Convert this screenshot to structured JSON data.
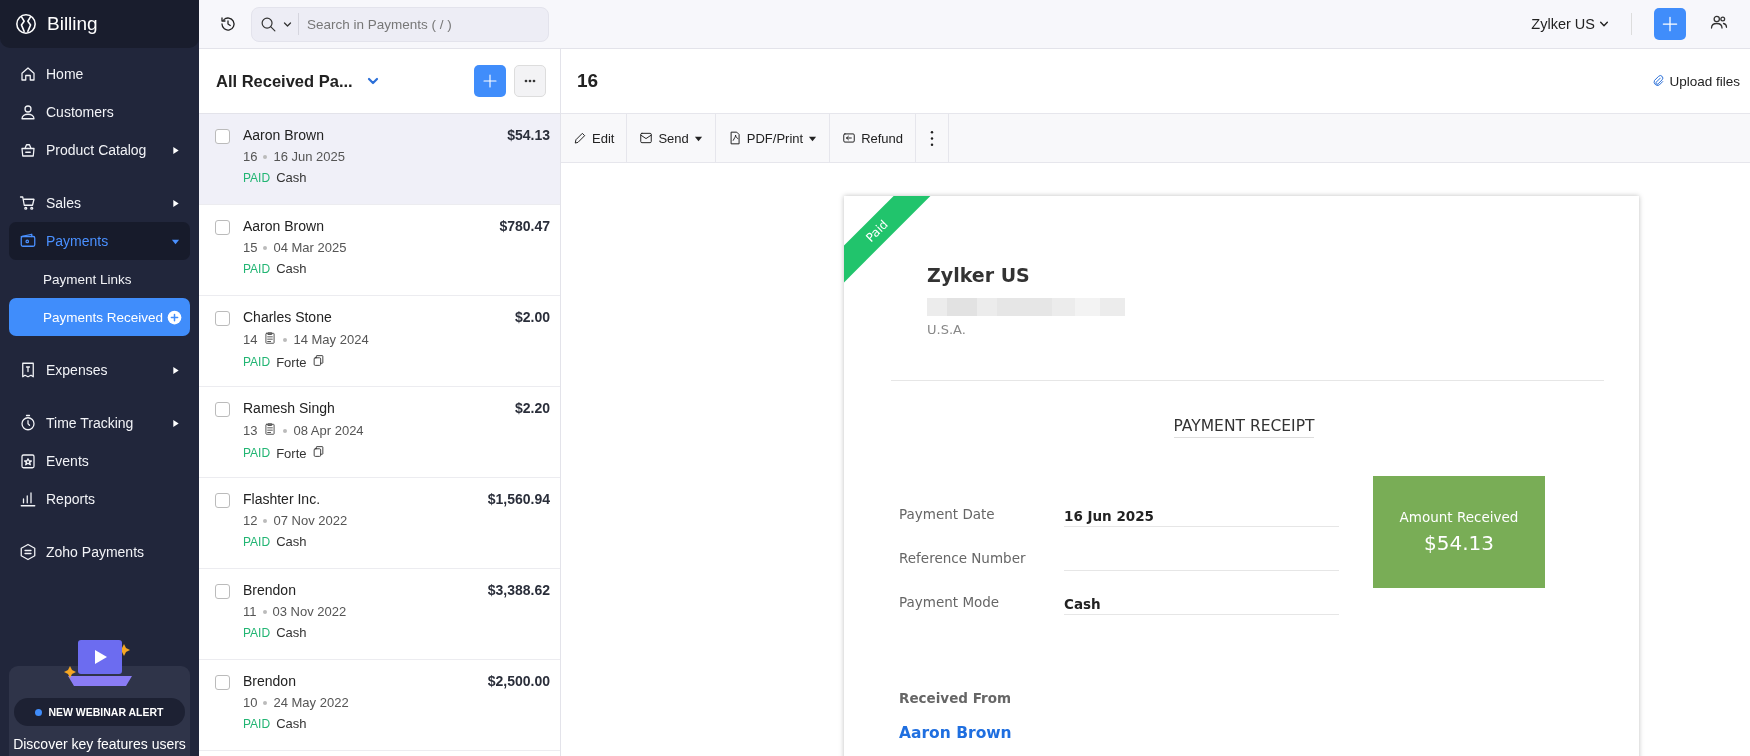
{
  "app": {
    "name": "Billing"
  },
  "sidebar": {
    "groups": [
      [
        {
          "label": "Home",
          "selected": false
        },
        {
          "label": "Customers",
          "selected": false
        },
        {
          "label": "Product Catalog",
          "selected": false,
          "expanded": false
        }
      ],
      [
        {
          "label": "Sales",
          "selected": false,
          "expanded": false
        },
        {
          "label": "Payments",
          "selected": true,
          "expanded": true,
          "children": [
            {
              "label": "Payment Links",
              "selected": false
            },
            {
              "label": "Payments Received",
              "selected": true
            }
          ]
        }
      ],
      [
        {
          "label": "Expenses",
          "selected": false,
          "expanded": false
        }
      ],
      [
        {
          "label": "Time Tracking",
          "selected": false,
          "expanded": false
        },
        {
          "label": "Events",
          "selected": false
        },
        {
          "label": "Reports",
          "selected": false
        }
      ],
      [
        {
          "label": "Zoho Payments",
          "selected": false
        }
      ]
    ],
    "promo": {
      "badge": "NEW WEBINAR ALERT",
      "text": "Discover key features users"
    }
  },
  "topbar": {
    "search": {
      "placeholder": "Search in Payments ( / )"
    },
    "organization": "Zylker US"
  },
  "list": {
    "title": "All Received Pa...",
    "rows": [
      {
        "name": "Aaron Brown",
        "amount": "$54.13",
        "number": "16",
        "date": "16 Jun 2025",
        "status": "PAID",
        "mode": "Cash",
        "selected": true,
        "has_note": false,
        "has_copy": false
      },
      {
        "name": "Aaron Brown",
        "amount": "$780.47",
        "number": "15",
        "date": "04 Mar 2025",
        "status": "PAID",
        "mode": "Cash",
        "selected": false,
        "has_note": false,
        "has_copy": false
      },
      {
        "name": "Charles Stone",
        "amount": "$2.00",
        "number": "14",
        "date": "14 May 2024",
        "status": "PAID",
        "mode": "Forte",
        "selected": false,
        "has_note": true,
        "has_copy": true
      },
      {
        "name": "Ramesh Singh",
        "amount": "$2.20",
        "number": "13",
        "date": "08 Apr 2024",
        "status": "PAID",
        "mode": "Forte",
        "selected": false,
        "has_note": true,
        "has_copy": true
      },
      {
        "name": "Flashter Inc.",
        "amount": "$1,560.94",
        "number": "12",
        "date": "07 Nov 2022",
        "status": "PAID",
        "mode": "Cash",
        "selected": false,
        "has_note": false,
        "has_copy": false
      },
      {
        "name": "Brendon",
        "amount": "$3,388.62",
        "number": "11",
        "date": "03 Nov 2022",
        "status": "PAID",
        "mode": "Cash",
        "selected": false,
        "has_note": false,
        "has_copy": false
      },
      {
        "name": "Brendon",
        "amount": "$2,500.00",
        "number": "10",
        "date": "24 May 2022",
        "status": "PAID",
        "mode": "Cash",
        "selected": false,
        "has_note": false,
        "has_copy": false
      }
    ]
  },
  "detail": {
    "title": "16",
    "upload": "Upload files",
    "toolbar": [
      {
        "label": "Edit",
        "dropdown": false
      },
      {
        "label": "Send",
        "dropdown": true
      },
      {
        "label": "PDF/Print",
        "dropdown": true
      },
      {
        "label": "Refund",
        "dropdown": false
      }
    ],
    "receipt": {
      "ribbon": "Paid",
      "company": "Zylker US",
      "country": "U.S.A.",
      "heading": "PAYMENT RECEIPT",
      "fields": [
        {
          "label": "Payment Date",
          "value": "16 Jun 2025"
        },
        {
          "label": "Reference Number"
        },
        {
          "label": "Payment Mode",
          "value": "Cash"
        }
      ],
      "amount_label": "Amount Received",
      "amount": "$54.13",
      "received_from_label": "Received From",
      "customer": "Aaron Brown"
    }
  }
}
